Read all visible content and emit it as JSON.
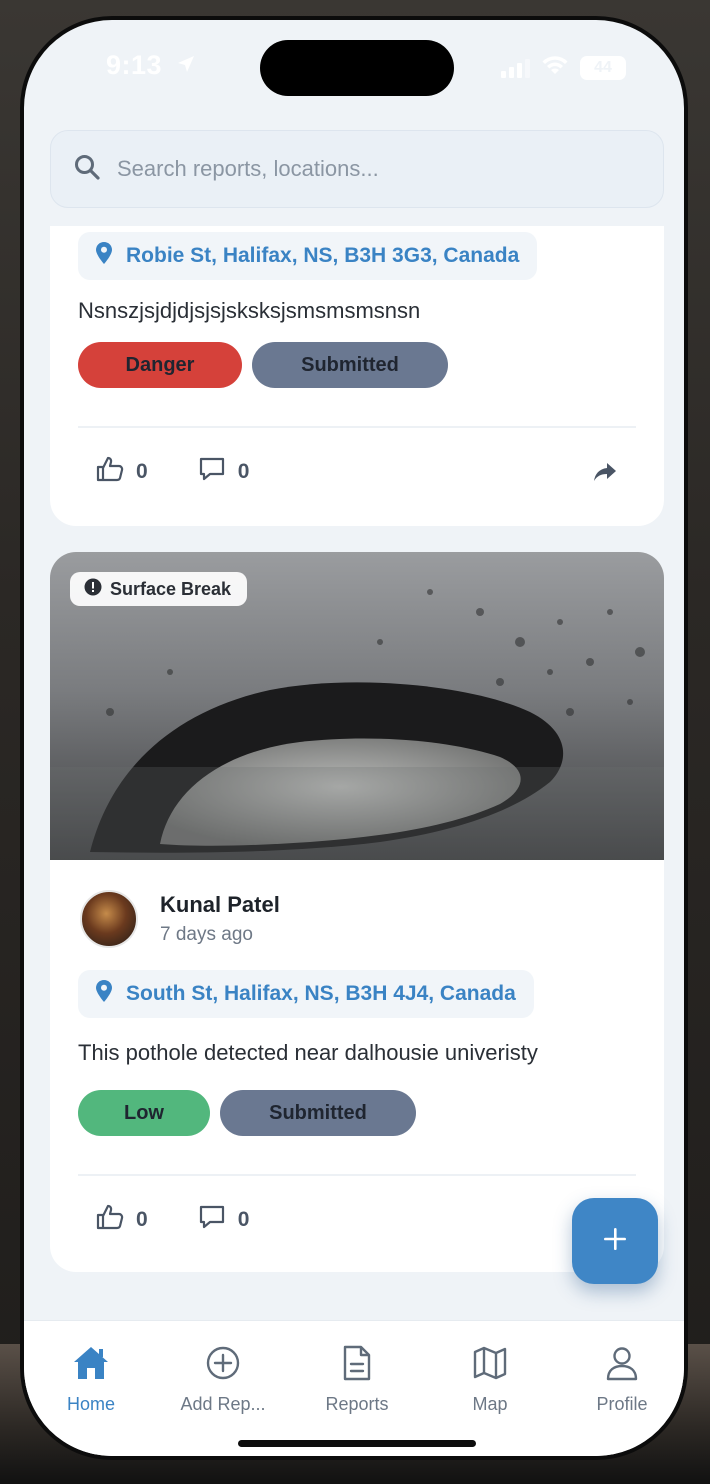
{
  "status": {
    "time": "9:13",
    "battery": "44"
  },
  "search": {
    "placeholder": "Search reports, locations..."
  },
  "reports": [
    {
      "location": "Robie St, Halifax, NS, B3H 3G3, Canada",
      "description": "Nsnszjsjdjdjsjsjsksksjsmsmsmsnsn",
      "severity": "Danger",
      "status": "Submitted",
      "likes": "0",
      "comments": "0",
      "colors": {
        "severity": "#d5413a",
        "status": "#6a7891"
      }
    },
    {
      "hazard_type": "Surface Break",
      "author": "Kunal Patel",
      "time_ago": "7 days ago",
      "location": "South St, Halifax, NS, B3H 4J4, Canada",
      "description": "This pothole detected near dalhousie univeristy",
      "severity": "Low",
      "status": "Submitted",
      "likes": "0",
      "comments": "0",
      "colors": {
        "severity": "#52b77d",
        "status": "#6a7891"
      }
    }
  ],
  "fab": {
    "icon": "plus-icon"
  },
  "tabs": [
    {
      "label": "Home",
      "icon": "home-icon",
      "active": true
    },
    {
      "label": "Add Rep...",
      "icon": "add-circle-icon",
      "active": false
    },
    {
      "label": "Reports",
      "icon": "document-icon",
      "active": false
    },
    {
      "label": "Map",
      "icon": "map-icon",
      "active": false
    },
    {
      "label": "Profile",
      "icon": "person-icon",
      "active": false
    }
  ],
  "theme": {
    "accent": "#3a83c4",
    "background": "#eff3f7"
  }
}
